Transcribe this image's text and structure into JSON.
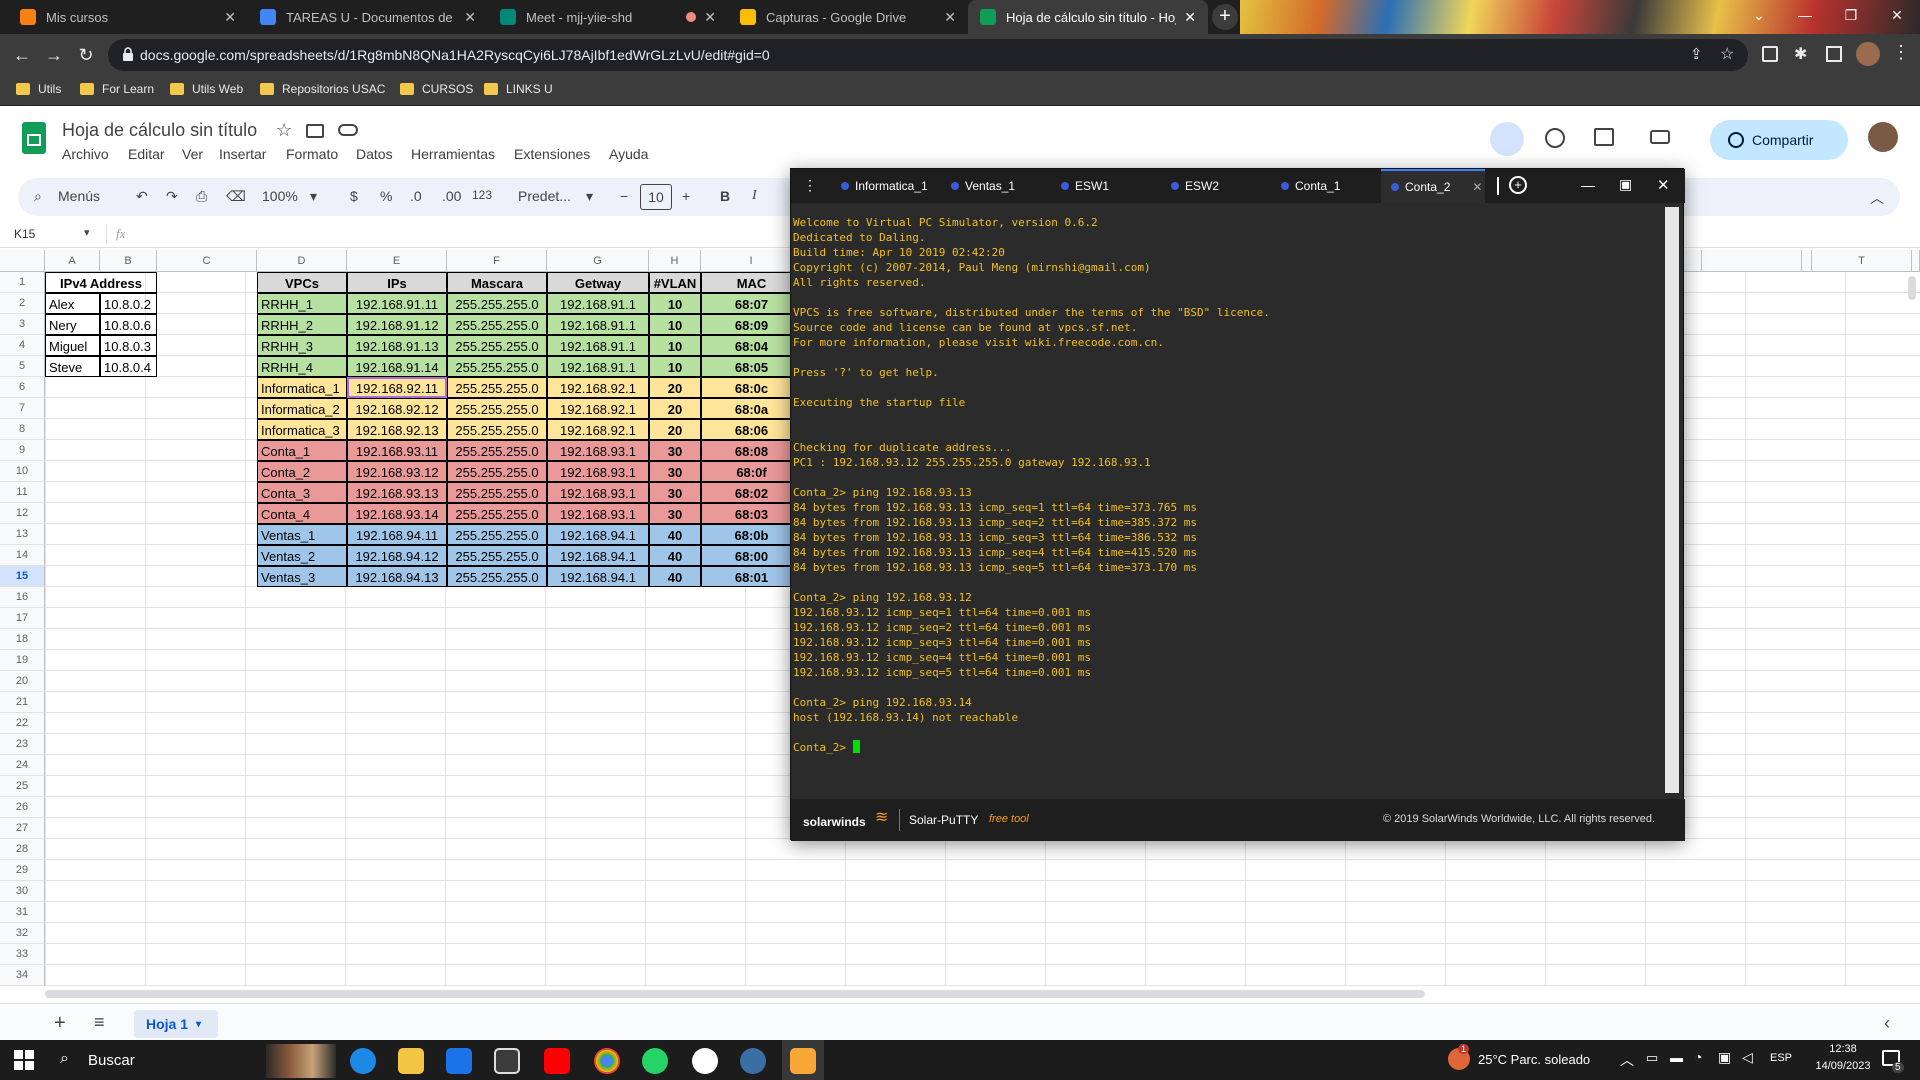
{
  "browser": {
    "tabs": [
      {
        "title": "Mis cursos",
        "icon": "moodle-icon",
        "icon_color": "#f98012"
      },
      {
        "title": "TAREAS U - Documentos de Goo",
        "icon": "docs-icon",
        "icon_color": "#4285f4"
      },
      {
        "title": "Meet - mjj-yiie-shd",
        "icon": "meet-icon",
        "icon_color": "#00897b"
      },
      {
        "title": "Capturas - Google Drive",
        "icon": "drive-icon",
        "icon_color": "#fbbc04"
      },
      {
        "title": "Hoja de cálculo sin título - Hojas",
        "icon": "sheets-icon",
        "icon_color": "#0f9d58"
      }
    ],
    "new_tab": "+",
    "url": "docs.google.com/spreadsheets/d/1Rg8mbN8QNa1HA2RyscqCyi6LJ78AjIbf1edWrGLzLvU/edit#gid=0",
    "bookmarks": [
      "Utils",
      "For Learn",
      "Utils Web",
      "Repositorios USAC",
      "CURSOS",
      "LINKS U"
    ]
  },
  "sheets": {
    "title": "Hoja de cálculo sin título",
    "menus": [
      "Archivo",
      "Editar",
      "Ver",
      "Insertar",
      "Formato",
      "Datos",
      "Herramientas",
      "Extensiones",
      "Ayuda"
    ],
    "share_label": "Compartir",
    "toolbar": {
      "search": "Menús",
      "zoom": "100%",
      "currency": "$",
      "percent": "%",
      "dec_minus": ".0",
      "dec_plus": ".00",
      "number_format": "123",
      "font": "Predet...",
      "font_size": "10",
      "bold": "B",
      "italic": "I",
      "minus": "−",
      "plus": "+"
    },
    "name_box": "K15",
    "fx": "fx",
    "columns": [
      "A",
      "B",
      "C",
      "D",
      "E",
      "F",
      "G",
      "H",
      "I",
      "S",
      "T"
    ],
    "ipv4_header": "IPv4 Address",
    "ipv4_rows": [
      {
        "name": "Alex",
        "ip": "10.8.0.2"
      },
      {
        "name": "Nery",
        "ip": "10.8.0.6"
      },
      {
        "name": "Miguel",
        "ip": "10.8.0.3"
      },
      {
        "name": "Steve",
        "ip": "10.8.0.4"
      }
    ],
    "table_headers": [
      "VPCs",
      "IPs",
      "Mascara",
      "Getway",
      "#VLAN",
      "MAC"
    ],
    "table_rows": [
      {
        "vpc": "RRHH_1",
        "ip": "192.168.91.11",
        "mask": "255.255.255.0",
        "gw": "192.168.91.1",
        "vlan": "10",
        "mac": "68:07",
        "color": "#b7e1a1"
      },
      {
        "vpc": "RRHH_2",
        "ip": "192.168.91.12",
        "mask": "255.255.255.0",
        "gw": "192.168.91.1",
        "vlan": "10",
        "mac": "68:09",
        "color": "#b7e1a1"
      },
      {
        "vpc": "RRHH_3",
        "ip": "192.168.91.13",
        "mask": "255.255.255.0",
        "gw": "192.168.91.1",
        "vlan": "10",
        "mac": "68:04",
        "color": "#b7e1a1"
      },
      {
        "vpc": "RRHH_4",
        "ip": "192.168.91.14",
        "mask": "255.255.255.0",
        "gw": "192.168.91.1",
        "vlan": "10",
        "mac": "68:05",
        "color": "#b7e1a1"
      },
      {
        "vpc": "Informatica_1",
        "ip": "192.168.92.11",
        "mask": "255.255.255.0",
        "gw": "192.168.92.1",
        "vlan": "20",
        "mac": "68:0c",
        "color": "#ffe599"
      },
      {
        "vpc": "Informatica_2",
        "ip": "192.168.92.12",
        "mask": "255.255.255.0",
        "gw": "192.168.92.1",
        "vlan": "20",
        "mac": "68:0a",
        "color": "#ffe599"
      },
      {
        "vpc": "Informatica_3",
        "ip": "192.168.92.13",
        "mask": "255.255.255.0",
        "gw": "192.168.92.1",
        "vlan": "20",
        "mac": "68:06",
        "color": "#ffe599"
      },
      {
        "vpc": "Conta_1",
        "ip": "192.168.93.11",
        "mask": "255.255.255.0",
        "gw": "192.168.93.1",
        "vlan": "30",
        "mac": "68:08",
        "color": "#ea9999"
      },
      {
        "vpc": "Conta_2",
        "ip": "192.168.93.12",
        "mask": "255.255.255.0",
        "gw": "192.168.93.1",
        "vlan": "30",
        "mac": "68:0f",
        "color": "#ea9999"
      },
      {
        "vpc": "Conta_3",
        "ip": "192.168.93.13",
        "mask": "255.255.255.0",
        "gw": "192.168.93.1",
        "vlan": "30",
        "mac": "68:02",
        "color": "#ea9999"
      },
      {
        "vpc": "Conta_4",
        "ip": "192.168.93.14",
        "mask": "255.255.255.0",
        "gw": "192.168.93.1",
        "vlan": "30",
        "mac": "68:03",
        "color": "#ea9999"
      },
      {
        "vpc": "Ventas_1",
        "ip": "192.168.94.11",
        "mask": "255.255.255.0",
        "gw": "192.168.94.1",
        "vlan": "40",
        "mac": "68:0b",
        "color": "#9fc5e8"
      },
      {
        "vpc": "Ventas_2",
        "ip": "192.168.94.12",
        "mask": "255.255.255.0",
        "gw": "192.168.94.1",
        "vlan": "40",
        "mac": "68:00",
        "color": "#9fc5e8"
      },
      {
        "vpc": "Ventas_3",
        "ip": "192.168.94.13",
        "mask": "255.255.255.0",
        "gw": "192.168.94.1",
        "vlan": "40",
        "mac": "68:01",
        "color": "#9fc5e8"
      }
    ],
    "row_numbers": [
      "1",
      "2",
      "3",
      "4",
      "5",
      "6",
      "7",
      "8",
      "9",
      "10",
      "11",
      "12",
      "13",
      "14",
      "15",
      "16",
      "17",
      "18",
      "19",
      "20",
      "21",
      "22",
      "23",
      "24",
      "25",
      "26",
      "27",
      "28",
      "29",
      "30",
      "31",
      "32",
      "33",
      "34"
    ],
    "sheet_tab": "Hoja 1"
  },
  "putty": {
    "tabs": [
      "Informatica_1",
      "Ventas_1",
      "ESW1",
      "ESW2",
      "Conta_1",
      "Conta_2"
    ],
    "active_tab": "Conta_2",
    "terminal_lines": [
      "Welcome to Virtual PC Simulator, version 0.6.2",
      "Dedicated to Daling.",
      "Build time: Apr 10 2019 02:42:20",
      "Copyright (c) 2007-2014, Paul Meng (mirnshi@gmail.com)",
      "All rights reserved.",
      "",
      "VPCS is free software, distributed under the terms of the \"BSD\" licence.",
      "Source code and license can be found at vpcs.sf.net.",
      "For more information, please visit wiki.freecode.com.cn.",
      "",
      "Press '?' to get help.",
      "",
      "Executing the startup file",
      "",
      "",
      "Checking for duplicate address...",
      "PC1 : 192.168.93.12 255.255.255.0 gateway 192.168.93.1",
      "",
      "Conta_2> ping 192.168.93.13",
      "84 bytes from 192.168.93.13 icmp_seq=1 ttl=64 time=373.765 ms",
      "84 bytes from 192.168.93.13 icmp_seq=2 ttl=64 time=385.372 ms",
      "84 bytes from 192.168.93.13 icmp_seq=3 ttl=64 time=386.532 ms",
      "84 bytes from 192.168.93.13 icmp_seq=4 ttl=64 time=415.520 ms",
      "84 bytes from 192.168.93.13 icmp_seq=5 ttl=64 time=373.170 ms",
      "",
      "Conta_2> ping 192.168.93.12",
      "192.168.93.12 icmp_seq=1 ttl=64 time=0.001 ms",
      "192.168.93.12 icmp_seq=2 ttl=64 time=0.001 ms",
      "192.168.93.12 icmp_seq=3 ttl=64 time=0.001 ms",
      "192.168.93.12 icmp_seq=4 ttl=64 time=0.001 ms",
      "192.168.93.12 icmp_seq=5 ttl=64 time=0.001 ms",
      "",
      "Conta_2> ping 192.168.93.14",
      "host (192.168.93.14) not reachable",
      ""
    ],
    "prompt": "Conta_2> ",
    "footer_brand": "solarwinds",
    "footer_app": "Solar-PuTTY",
    "footer_free": "free tool",
    "footer_copyright": "© 2019 SolarWinds Worldwide, LLC. All rights reserved."
  },
  "taskbar": {
    "search": "Buscar",
    "weather": "25°C  Parc. soleado",
    "lang": "ESP",
    "time": "12:38",
    "date": "14/09/2023",
    "notif_count": "5",
    "weather_badge": "1"
  }
}
